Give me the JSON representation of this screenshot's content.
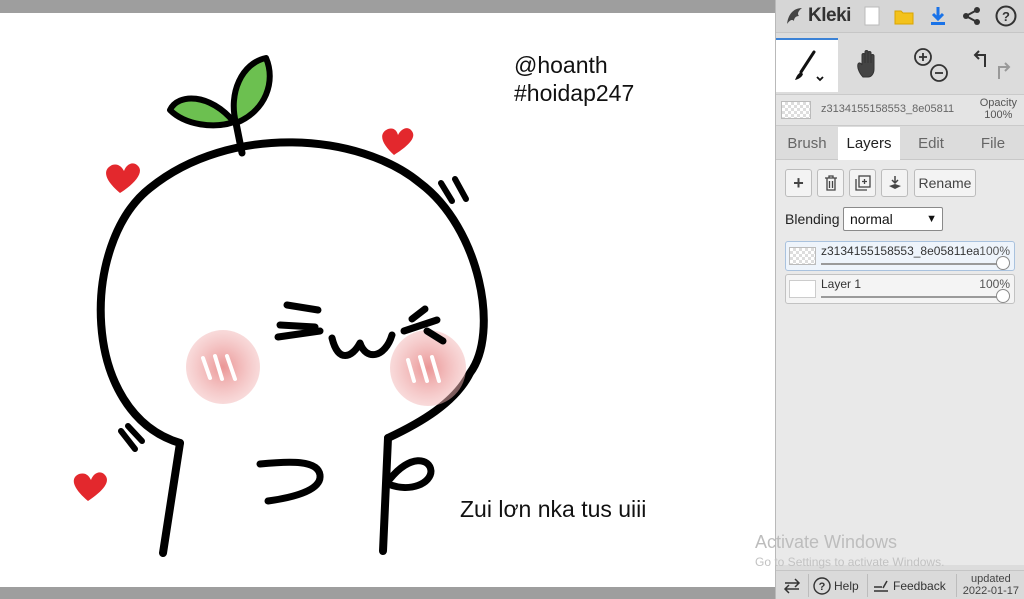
{
  "canvas": {
    "handle_text": "@hoanth",
    "hashtag_text": "#hoidap247",
    "caption_text": "Zui lơn nka tus uiii"
  },
  "app": {
    "logo_text": "Kleki",
    "top_icons": [
      "new-image-icon",
      "open-folder-icon",
      "download-icon",
      "share-icon",
      "help-icon"
    ],
    "accent_color": "#3b82d6"
  },
  "tools": [
    "brush-tool-icon",
    "hand-tool-icon",
    "zoom-in-icon",
    "zoom-out-icon",
    "undo-icon",
    "redo-icon"
  ],
  "layer_info": {
    "name": "z3134155158553_8e05811",
    "opacity_label": "Opacity",
    "opacity_value": "100%"
  },
  "tabs": [
    {
      "label": "Brush",
      "active": false
    },
    {
      "label": "Layers",
      "active": true
    },
    {
      "label": "Edit",
      "active": false
    },
    {
      "label": "File",
      "active": false
    }
  ],
  "layers_panel": {
    "rename_label": "Rename",
    "blending_label": "Blending",
    "blending_value": "normal",
    "layers": [
      {
        "name": "z3134155158553_8e05811ea",
        "opacity": "100%",
        "selected": true
      },
      {
        "name": "Layer 1",
        "opacity": "100%",
        "selected": false
      }
    ]
  },
  "watermark": {
    "line1": "Activate Windows",
    "line2": "Go to Settings to activate Windows."
  },
  "bottom_bar": {
    "help_label": "Help",
    "feedback_label": "Feedback",
    "updated_label": "updated",
    "updated_date": "2022-01-17"
  }
}
